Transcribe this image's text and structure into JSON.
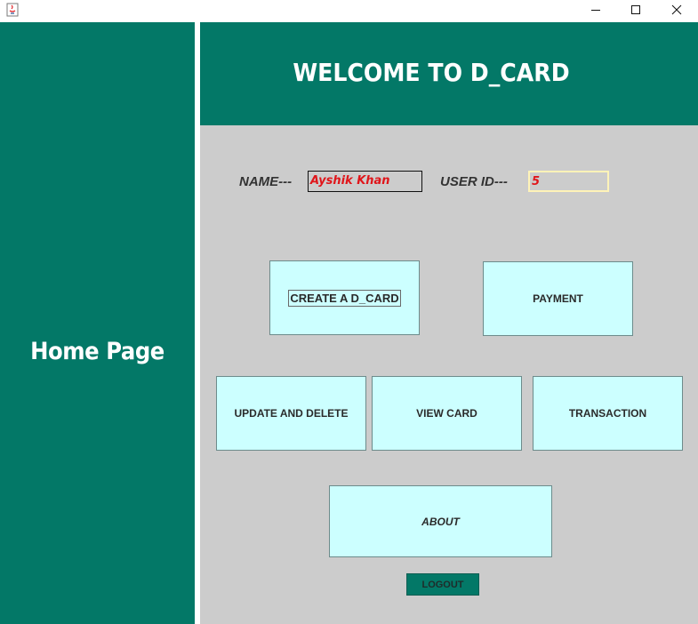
{
  "window": {
    "icons": {
      "app": "java-app-icon",
      "minimize": "minimize-icon",
      "maximize": "maximize-icon",
      "close": "close-icon"
    }
  },
  "sidebar": {
    "title": "Home Page"
  },
  "header": {
    "title": "WELCOME TO D_CARD"
  },
  "user": {
    "name_label": "NAME---",
    "name_value": "Ayshik Khan",
    "id_label": "USER ID---",
    "id_value": "5"
  },
  "buttons": {
    "create": "CREATE A D_CARD",
    "payment": "PAYMENT",
    "update": "UPDATE AND DELETE",
    "view": "VIEW CARD",
    "transaction": "TRANSACTION",
    "about": "ABOUT",
    "logout": "LOGOUT"
  },
  "colors": {
    "primary": "#037867",
    "content_bg": "#cccccc",
    "button_bg": "#ccffff",
    "field_text": "#e0151a"
  }
}
